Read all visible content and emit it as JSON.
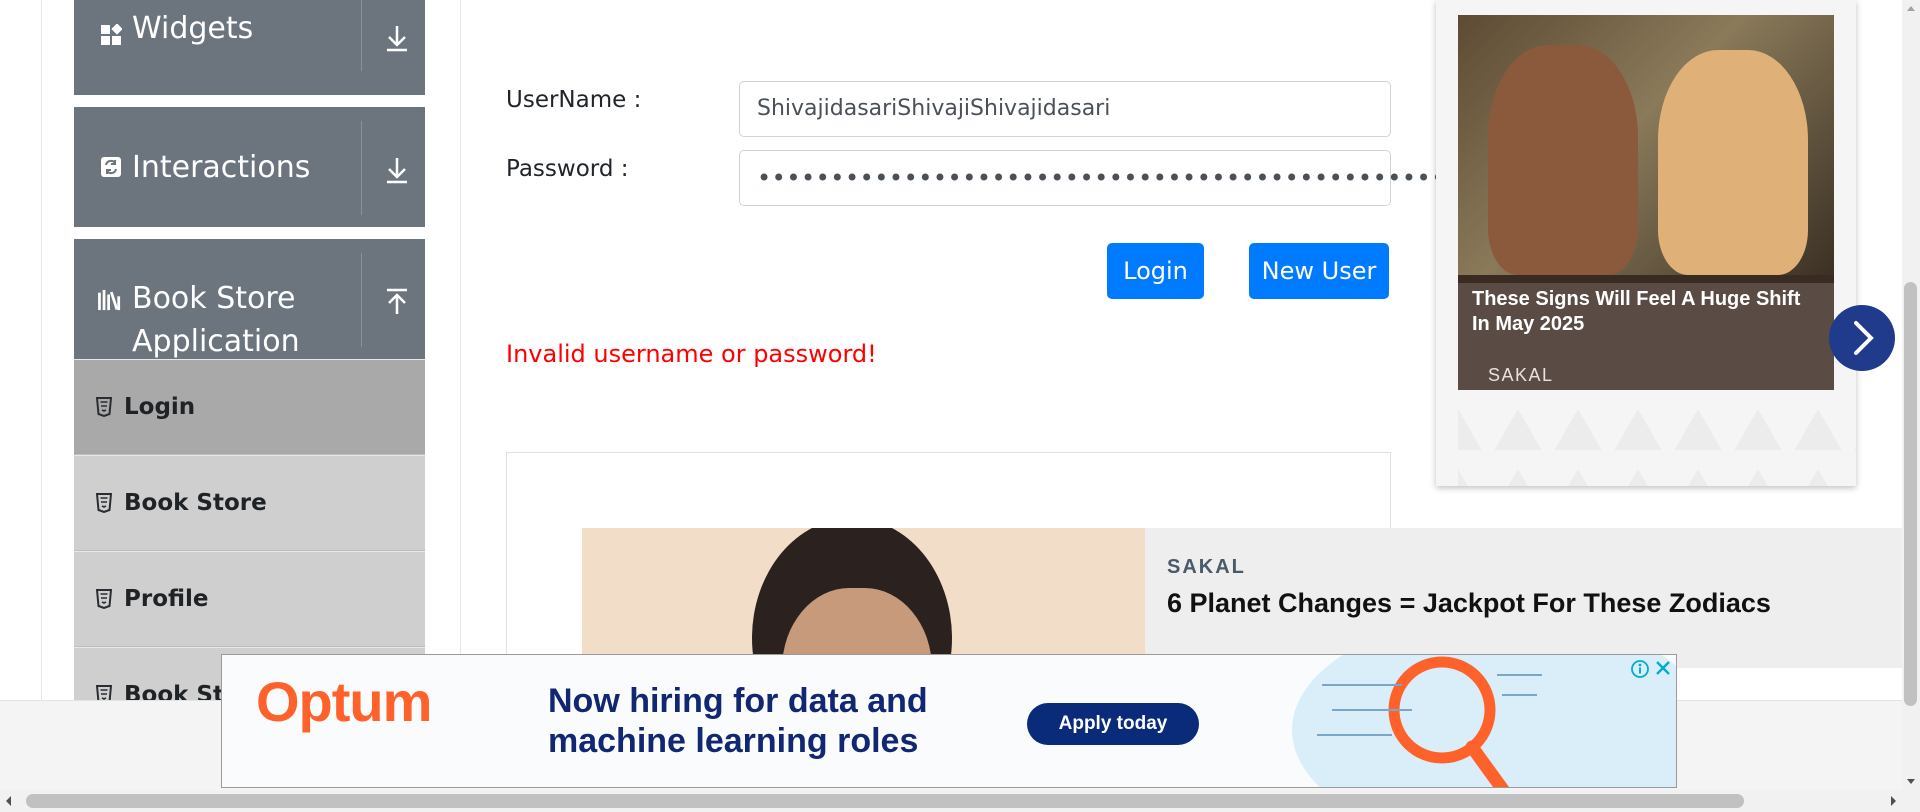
{
  "sidebar": {
    "groups": [
      {
        "label": "Widgets",
        "icon": "widgets-icon"
      },
      {
        "label": "Interactions",
        "icon": "interactions-icon"
      },
      {
        "label_line1": "Book Store",
        "label_line2": "Application",
        "icon": "books-icon"
      }
    ],
    "items": [
      {
        "label": "Login"
      },
      {
        "label": "Book Store"
      },
      {
        "label": "Profile"
      },
      {
        "label": "Book Sto"
      }
    ]
  },
  "form": {
    "username_label": "UserName :",
    "username_value": "ShivajidasariShivajiShivajidasari",
    "password_label": "Password :",
    "password_value": "••••••••••••••••••••••••••••••••••••••••••••••••",
    "login_button": "Login",
    "new_user_button": "New User",
    "error": "Invalid username or password!"
  },
  "native_ad": {
    "source": "SAKAL",
    "headline": "6 Planet Changes = Jackpot For These Zodiacs"
  },
  "side_ad": {
    "caption": "These Signs Will Feel A Huge Shift In May 2025",
    "source": "SAKAL"
  },
  "banner_ad": {
    "brand": "Optum",
    "message": "Now hiring for data and machine learning roles",
    "cta": "Apply today"
  },
  "colors": {
    "primary": "#007bff",
    "sidebar_group": "#6c757d",
    "error": "#ff0000",
    "brand_orange": "#ff612b",
    "brand_navy": "#122771"
  }
}
